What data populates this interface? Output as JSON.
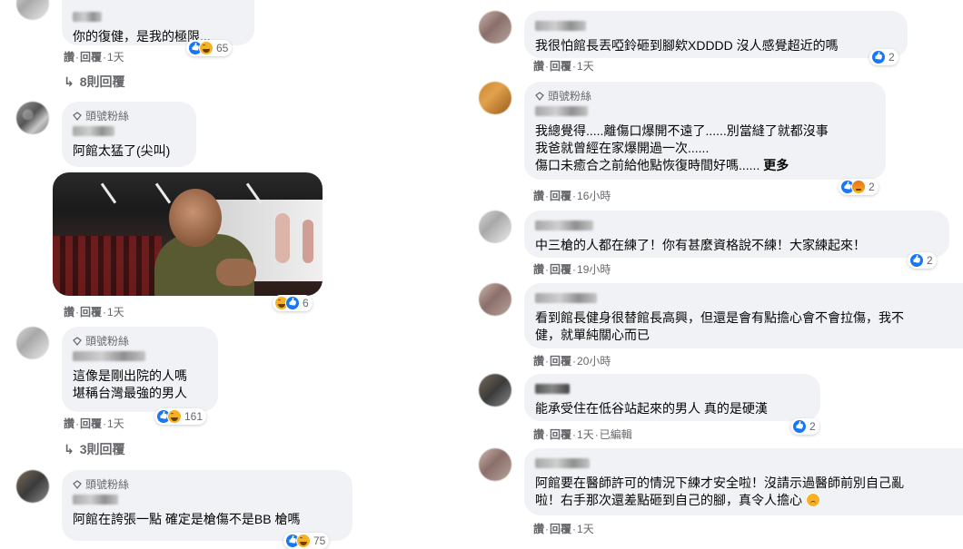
{
  "labels": {
    "like": "讚",
    "reply": "回覆",
    "dot": "·",
    "top_fan": "頭號粉絲"
  },
  "left": {
    "c1": {
      "text": "你的復健，是我的極限...",
      "reactions": [
        "like",
        "haha"
      ],
      "count": "65",
      "time": "1天",
      "replies": "8則回覆"
    },
    "c2": {
      "badge": true,
      "text": "阿館太猛了(尖叫)",
      "gif_reactions": [
        "haha",
        "like"
      ],
      "gif_count": "6",
      "time": "1天"
    },
    "c3": {
      "badge": true,
      "text": "這像是剛出院的人嗎\n堪稱台灣最強的男人",
      "reactions": [
        "like",
        "haha"
      ],
      "count": "161",
      "time": "1天",
      "replies": "3則回覆"
    },
    "c4": {
      "badge": true,
      "text": "阿館在誇張一點 確定是槍傷不是BB 槍嗎",
      "count": "75"
    }
  },
  "right": {
    "c1": {
      "text": "我很怕館長丟啞鈴砸到腳欸XDDDD 沒人感覺超近的嗎",
      "reactions": [
        "like"
      ],
      "count": "2",
      "time": "1天"
    },
    "c2": {
      "badge": true,
      "text": "我總覺得.....離傷口爆開不遠了......別當縫了就都沒事\n我爸就曾經在家爆開過一次......\n傷口未癒合之前給他點恢復時間好嗎......",
      "more": "更多",
      "reactions": [
        "like",
        "angry"
      ],
      "count": "2",
      "time": "16小時"
    },
    "c3": {
      "text": "中三槍的人都在練了！你有甚麼資格說不練！大家練起來！",
      "reactions": [
        "like"
      ],
      "count": "2",
      "time": "19小時"
    },
    "c4": {
      "text": "看到館長健身很替館長高興，但還是會有點擔心會不會拉傷，我不\n健，就單純關心而已",
      "time": "20小時"
    },
    "c5": {
      "text": "能承受住在低谷站起來的男人 真的是硬漢",
      "reactions": [
        "like"
      ],
      "count": "2",
      "time": "1天",
      "edited": "已編輯"
    },
    "c6": {
      "text": "阿館要在醫師許可的情況下練才安全啦！沒請示過醫師前別自己亂\n啦！右手那次還差點砸到自己的腳，真令人擔心",
      "time": "1天"
    }
  },
  "colors": {
    "bubble": "#f0f2f5",
    "meta": "#65676b",
    "like_blue": "#1877f2",
    "reaction_yellow": "#f7b125"
  }
}
